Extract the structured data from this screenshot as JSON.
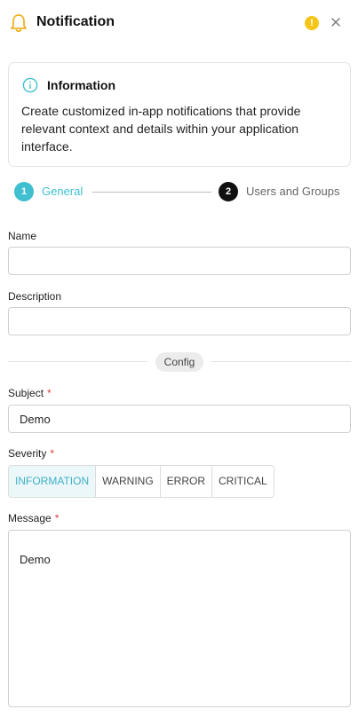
{
  "header": {
    "title": "Notification",
    "warn_glyph": "!",
    "icons": {
      "bell": "bell-icon",
      "warning": "warning-icon",
      "close": "close-icon"
    }
  },
  "info": {
    "title": "Information",
    "text": "Create customized in-app notifications that provide relevant context and details within your application interface."
  },
  "steps": [
    {
      "number": "1",
      "label": "General",
      "active": true
    },
    {
      "number": "2",
      "label": "Users and Groups",
      "active": false
    }
  ],
  "form": {
    "name": {
      "label": "Name",
      "value": ""
    },
    "description": {
      "label": "Description",
      "value": ""
    },
    "config_label": "Config",
    "subject": {
      "label": "Subject",
      "required_mark": "*",
      "value": "Demo"
    },
    "severity": {
      "label": "Severity",
      "required_mark": "*",
      "options": [
        "INFORMATION",
        "WARNING",
        "ERROR",
        "CRITICAL"
      ],
      "selected": "INFORMATION"
    },
    "message": {
      "label": "Message",
      "required_mark": "*",
      "value": "Demo"
    }
  },
  "colors": {
    "accent": "#3fbfcf",
    "warning": "#f5c518",
    "required": "#e23b3b",
    "bell": "#f2b01e"
  }
}
